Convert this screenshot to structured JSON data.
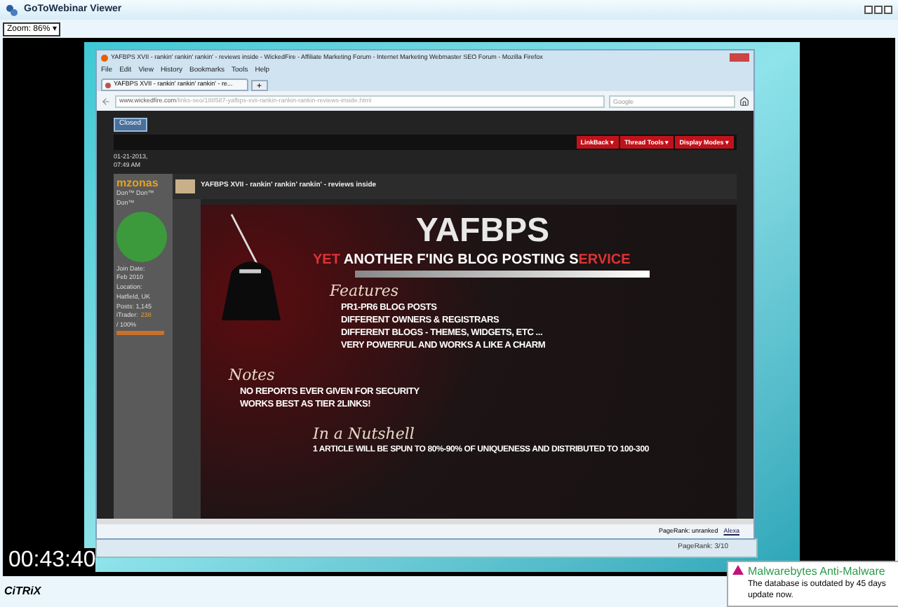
{
  "viewer": {
    "title": "GoToWebinar Viewer",
    "zoom": "Zoom: 86%",
    "zoom_caret": "▾",
    "timer": "00:43:40",
    "logo": "CiTRiX"
  },
  "browser": {
    "title": "YAFBPS XVII - rankin' rankin' rankin' - reviews inside - WickedFire - Affiliate Marketing Forum - Internet Marketing Webmaster SEO Forum - Mozilla Firefox",
    "menu": [
      "File",
      "Edit",
      "View",
      "History",
      "Bookmarks",
      "Tools",
      "Help"
    ],
    "tab": "YAFBPS XVII - rankin' rankin' rankin' - re...",
    "new_tab": "+",
    "url_host": "www.wickedfire.com",
    "url_path": "/links-seo/188587-yafbps-xvii-rankin-rankin-rankin-reviews-inside.html",
    "search_placeholder": "Google",
    "pagerank": "PageRank: unranked",
    "alexa": "Alexa"
  },
  "back_window": {
    "pagerank": "PageRank: 3/10"
  },
  "forum": {
    "closed": "Closed",
    "thread_buttons": [
      "LinkBack ▾",
      "Thread Tools ▾",
      "Display Modes ▾"
    ],
    "post_date": "01-21-2013,",
    "post_time": "07:49 AM",
    "user": {
      "name": "mzonas",
      "title": "Don™ Don™ Don™",
      "details": [
        "Join Date:",
        "Feb 2010",
        "Location:",
        "Hatfield, UK",
        "Posts: 1,145"
      ],
      "itrader_label": "iTrader:",
      "itrader_value": "238",
      "itrader_pct": "/ 100%"
    },
    "post_title": "YAFBPS XVII - rankin' rankin' rankin' - reviews inside",
    "banner": {
      "logo": "YAFBPS",
      "tagline_red": "YET",
      "tagline_white": "ANOTHER  F'ING BLOG POSTING S",
      "tagline_end": "ERVICE",
      "sections": [
        {
          "heading": "Features",
          "items": [
            "PR1-PR6 BLOG POSTS",
            "DIFFERENT OWNERS & REGISTRARS",
            "DIFFERENT BLOGS - THEMES, WIDGETS, ETC ...",
            "VERY POWERFUL AND WORKS A LIKE A CHARM"
          ]
        },
        {
          "heading": "Notes",
          "items": [
            "NO REPORTS EVER GIVEN FOR SECURITY",
            "WORKS BEST AS TIER 2LINKS!"
          ]
        },
        {
          "heading": "In a Nutshell",
          "items": [
            "1 ARTICLE WILL BE SPUN TO 80%-90% OF UNIQUENESS AND  DISTRIBUTED TO 100-300"
          ]
        }
      ]
    }
  },
  "notification": {
    "title": "Malwarebytes Anti-Malware",
    "lines": [
      "The database is outdated by 45 days",
      "update now."
    ]
  }
}
